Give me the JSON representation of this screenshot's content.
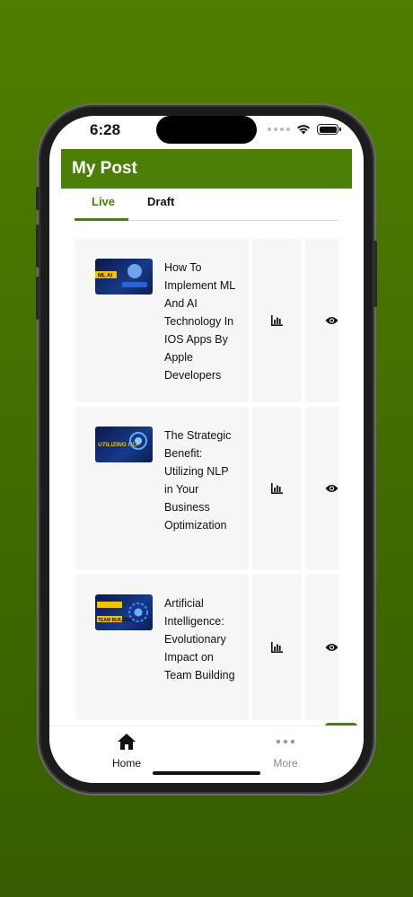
{
  "status_bar": {
    "time": "6:28"
  },
  "header": {
    "title": "My Post"
  },
  "tabs": [
    {
      "label": "Live",
      "active": true
    },
    {
      "label": "Draft",
      "active": false
    }
  ],
  "posts": [
    {
      "title": "How To Implement ML And AI Technology In IOS Apps By Apple Developers",
      "thumbnail_text": "ML AI",
      "stats_icon": "bar-chart-icon",
      "view_icon": "eye-icon"
    },
    {
      "title": "The Strategic Benefit: Utilizing NLP in Your Business Optimization",
      "thumbnail_text": "UTILIZING NLP",
      "stats_icon": "bar-chart-icon",
      "view_icon": "eye-icon"
    },
    {
      "title": "Artificial Intelligence: Evolutionary Impact on Team Building",
      "thumbnail_text": "TEAM BUILDING",
      "stats_icon": "bar-chart-icon",
      "view_icon": "eye-icon"
    }
  ],
  "bottom_nav": [
    {
      "label": "Home",
      "icon": "home-icon",
      "active": true
    },
    {
      "label": "More",
      "icon": "more-icon",
      "active": false
    }
  ],
  "colors": {
    "brand": "#4b7f07",
    "background": "#3e6a00",
    "card": "#f6f6f6"
  }
}
